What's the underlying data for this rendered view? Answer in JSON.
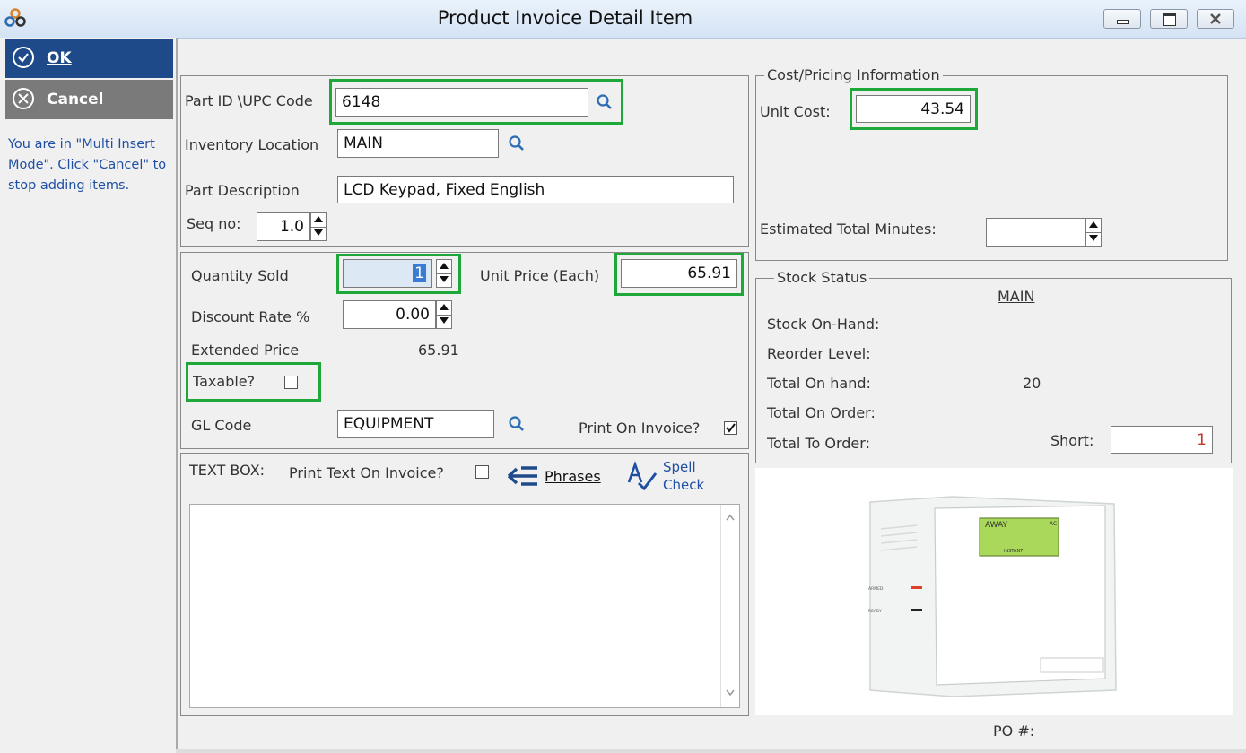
{
  "window": {
    "title": "Product Invoice Detail Item"
  },
  "sidebar": {
    "ok_label": "OK",
    "cancel_label": "Cancel",
    "message": "You are in \"Multi Insert Mode\". Click \"Cancel\" to stop adding items."
  },
  "part": {
    "part_id_label": "Part ID \\UPC Code",
    "part_id_value": "6148",
    "location_label": "Inventory Location",
    "location_value": "MAIN",
    "description_label": "Part Description",
    "description_value": "LCD Keypad, Fixed English",
    "seq_label": "Seq no:",
    "seq_value": "1.0"
  },
  "sale": {
    "qty_label": "Quantity Sold",
    "qty_value": "1",
    "unit_price_label": "Unit Price (Each)",
    "unit_price_value": "65.91",
    "discount_label": "Discount Rate %",
    "discount_value": "0.00",
    "extended_label": "Extended Price",
    "extended_value": "65.91",
    "taxable_label": "Taxable?",
    "taxable_checked": false,
    "gl_label": "GL Code",
    "gl_value": "EQUIPMENT",
    "print_invoice_label": "Print On Invoice?",
    "print_invoice_checked": true
  },
  "textbox": {
    "label": "TEXT BOX:",
    "print_text_label": "Print Text On Invoice?",
    "phrases_label": "Phrases",
    "spell_label_1": "Spell",
    "spell_label_2": "Check",
    "content": ""
  },
  "cost": {
    "group_label": "Cost/Pricing Information",
    "unit_cost_label": "Unit Cost:",
    "unit_cost_value": "43.54",
    "est_minutes_label": "Estimated Total Minutes:",
    "est_minutes_value": ""
  },
  "stock": {
    "group_label": "Stock Status",
    "location_header": "MAIN",
    "on_hand_label": "Stock On-Hand:",
    "reorder_label": "Reorder Level:",
    "total_on_hand_label": "Total On hand:",
    "total_on_hand_value": "20",
    "total_on_order_label": "Total On Order:",
    "total_to_order_label": "Total To Order:",
    "short_label": "Short:",
    "short_value": "1"
  },
  "product_image": {
    "display_text_1": "AWAY",
    "display_text_2": "AC",
    "display_text_3": "INSTANT",
    "led_1": "ARMED",
    "led_2": "READY"
  },
  "po": {
    "label": "PO #:"
  },
  "colors": {
    "highlight": "#1fa83a",
    "ok_bg": "#1f4a8a",
    "cancel_bg": "#7a7a7a",
    "link": "#1f4fa3",
    "short_value": "#c0392b"
  }
}
